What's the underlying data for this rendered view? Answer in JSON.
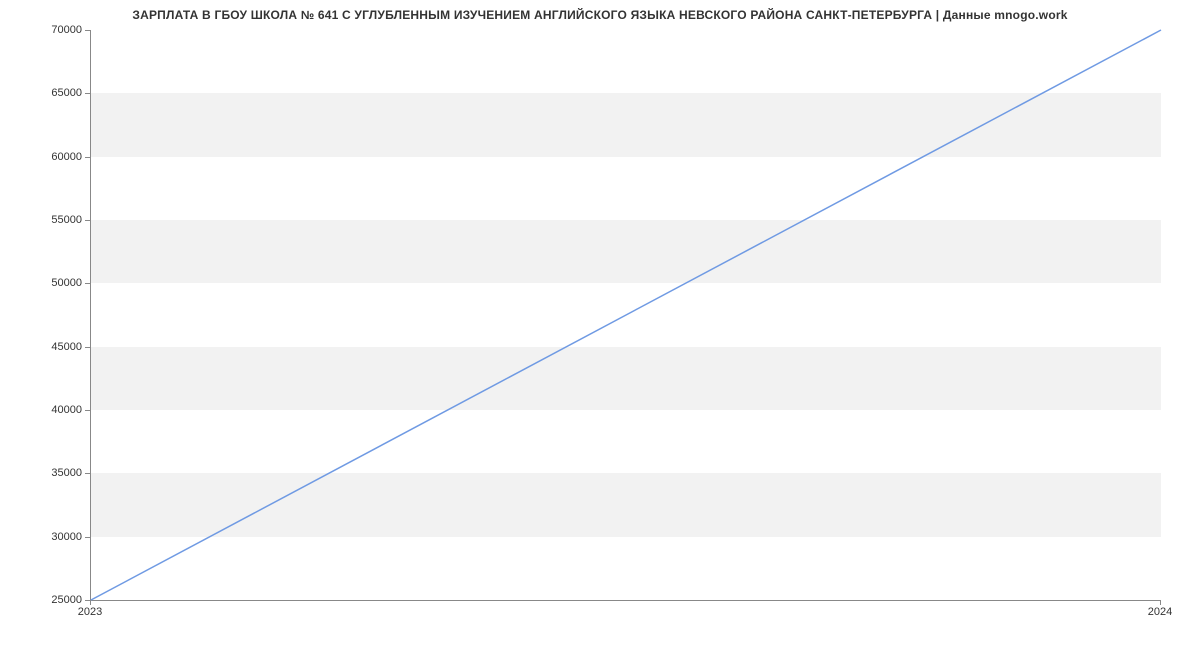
{
  "chart_data": {
    "type": "line",
    "title": "ЗАРПЛАТА В ГБОУ ШКОЛА № 641 С УГЛУБЛЕННЫМ ИЗУЧЕНИЕМ АНГЛИЙСКОГО ЯЗЫКА НЕВСКОГО РАЙОНА САНКТ-ПЕТЕРБУРГА | Данные mnogo.work",
    "x": [
      2023,
      2024
    ],
    "values": [
      25000,
      70000
    ],
    "x_ticks": [
      2023,
      2024
    ],
    "y_ticks": [
      25000,
      30000,
      35000,
      40000,
      45000,
      50000,
      55000,
      60000,
      65000,
      70000
    ],
    "ylim": [
      25000,
      70000
    ],
    "xlim": [
      2023,
      2024
    ],
    "xlabel": "",
    "ylabel": "",
    "line_color": "#6f9ae3"
  }
}
